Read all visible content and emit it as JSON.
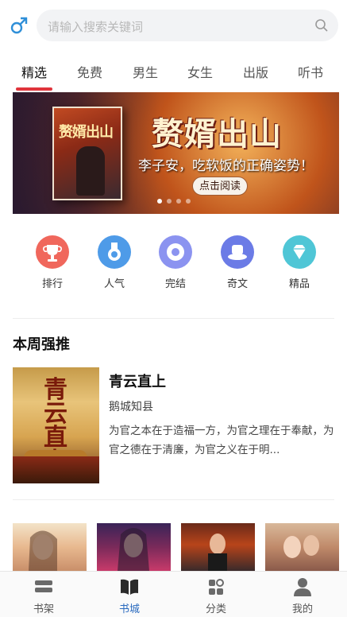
{
  "search": {
    "placeholder": "请输入搜索关键词"
  },
  "tabs": [
    {
      "label": "精选",
      "active": true
    },
    {
      "label": "免费"
    },
    {
      "label": "男生"
    },
    {
      "label": "女生"
    },
    {
      "label": "出版"
    },
    {
      "label": "听书"
    }
  ],
  "banner": {
    "cover_title": "赘婿出山",
    "title": "赘婿出山",
    "subtitle": "李子安，吃软饭的正确姿势！",
    "button_label": "点击阅读",
    "slide_count": 4,
    "active_slide": 1
  },
  "categories": [
    {
      "label": "排行",
      "icon": "trophy-icon",
      "color": "#f0675c"
    },
    {
      "label": "人气",
      "icon": "medal-icon",
      "color": "#4e9be8"
    },
    {
      "label": "完结",
      "icon": "disc-icon",
      "color": "#8b93f0"
    },
    {
      "label": "奇文",
      "icon": "hat-icon",
      "color": "#6b7be6"
    },
    {
      "label": "精品",
      "icon": "diamond-icon",
      "color": "#4fc6d6"
    }
  ],
  "weekly": {
    "section_title": "本周强推",
    "book": {
      "cover_title": "青云直上",
      "title": "青云直上",
      "author": "鹅城知县",
      "description": "为官之本在于造福一方，为官之理在于奉献，为官之德在于清廉，为官之义在于明..."
    }
  },
  "bottom_nav": [
    {
      "label": "书架",
      "icon": "bookshelf-icon",
      "active": false
    },
    {
      "label": "书城",
      "icon": "open-book-icon",
      "active": true
    },
    {
      "label": "分类",
      "icon": "category-grid-icon",
      "active": false
    },
    {
      "label": "我的",
      "icon": "user-icon",
      "active": false
    }
  ],
  "colors": {
    "accent_tab": "#e0343c",
    "accent_nav": "#2b6bbf"
  }
}
